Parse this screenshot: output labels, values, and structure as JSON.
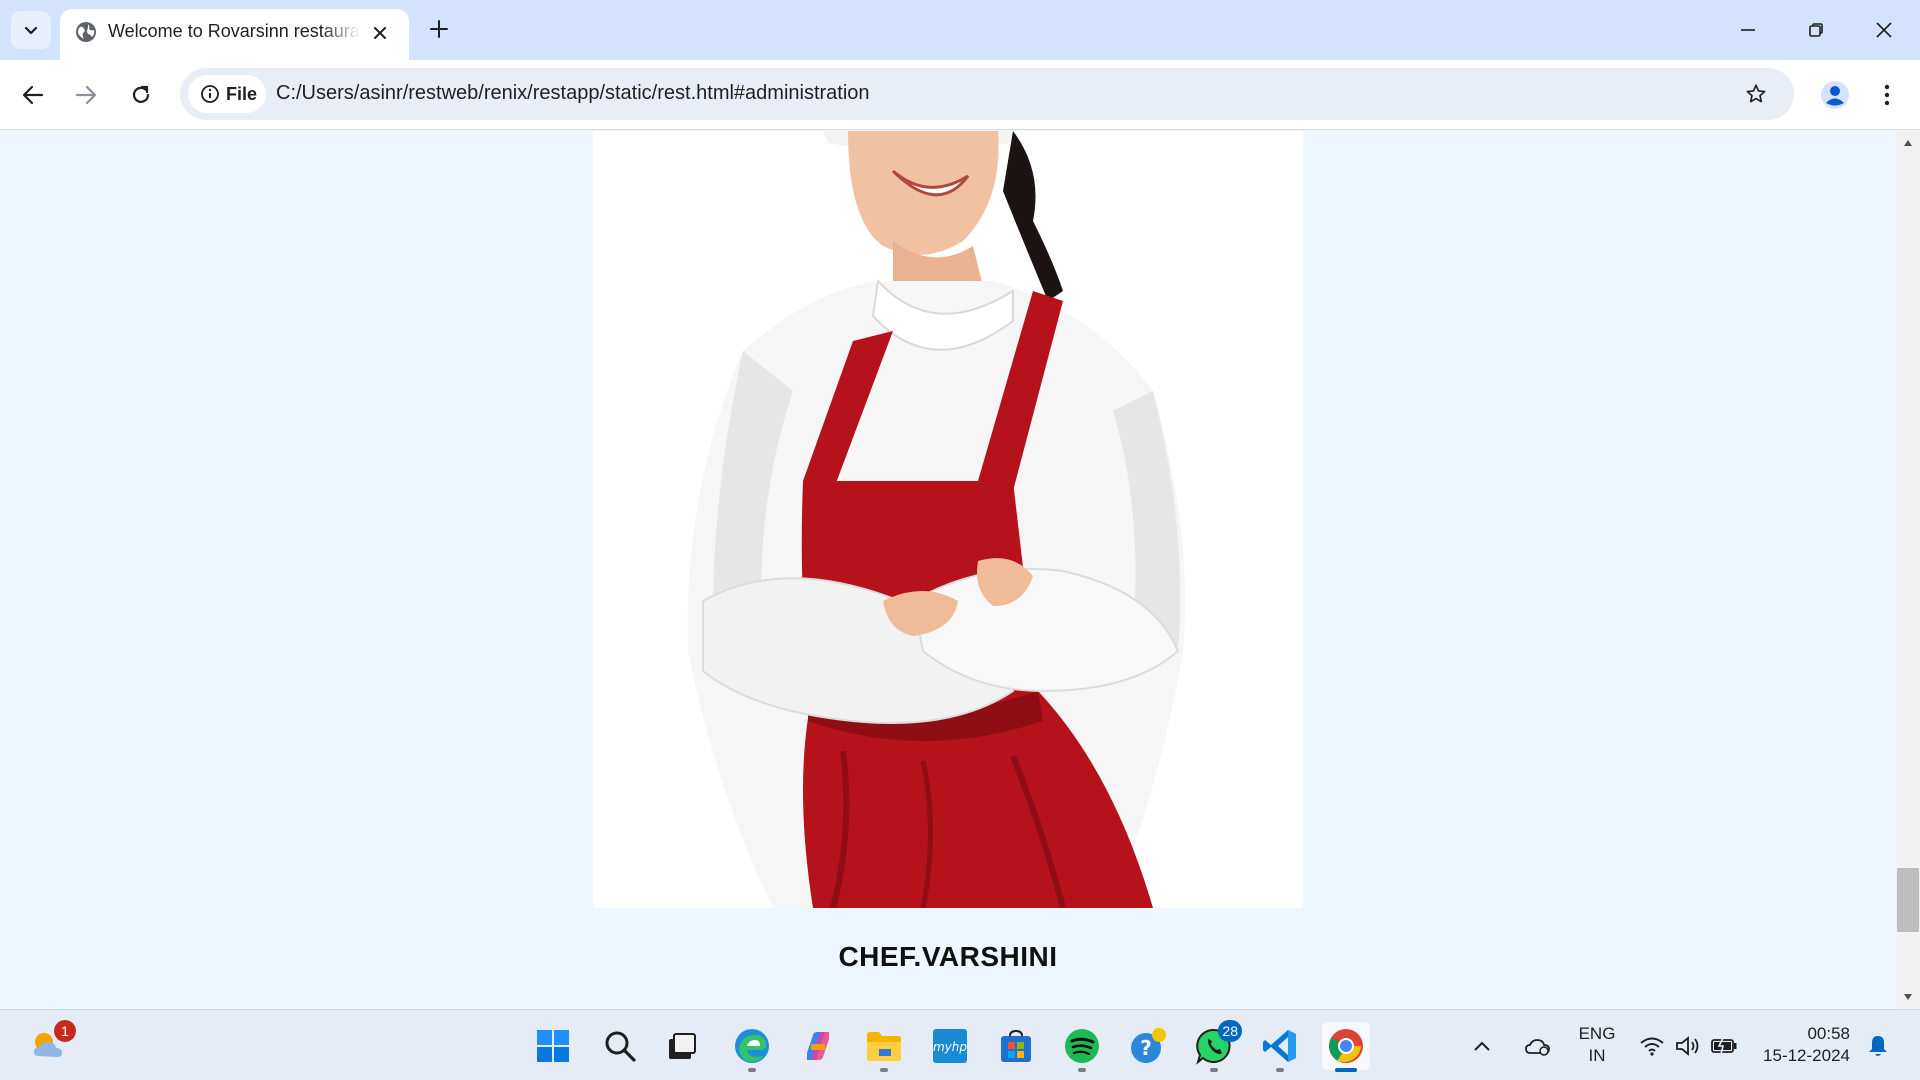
{
  "browser": {
    "tab_title": "Welcome to Rovarsinn restaurant",
    "new_tab_symbol": "+",
    "url": "C:/Users/asinr/restweb/renix/restapp/static/rest.html#administration",
    "site_chip_label": "File"
  },
  "page": {
    "chef_name": "CHEF.VARSHINI",
    "photo_alt": "Chef wearing white chef coat and red apron with crossed arms"
  },
  "taskbar": {
    "weather_badge": "1",
    "whatsapp_badge": "28",
    "language_line1": "ENG",
    "language_line2": "IN",
    "time": "00:58",
    "date": "15-12-2024"
  },
  "icons": [
    "tab-search-icon",
    "globe-icon",
    "close-icon",
    "plus-icon",
    "minimize-icon",
    "restore-icon",
    "back-icon",
    "forward-icon",
    "reload-icon",
    "info-icon",
    "star-icon",
    "profile-icon",
    "more-vert-icon",
    "windows-start-icon",
    "search-icon",
    "task-view-icon",
    "edge-icon",
    "copilot-icon",
    "file-explorer-icon",
    "myhp-icon",
    "store-icon",
    "spotify-icon",
    "help-icon",
    "whatsapp-icon",
    "vscode-icon",
    "chrome-icon",
    "chevron-up-icon",
    "onedrive-icon",
    "wifi-icon",
    "volume-icon",
    "battery-icon",
    "bell-icon"
  ],
  "colors": {
    "tabbar": "#d3e3fd",
    "page_bg": "#eef6ff",
    "apron_red": "#b5121b",
    "accent": "#0067c0"
  }
}
